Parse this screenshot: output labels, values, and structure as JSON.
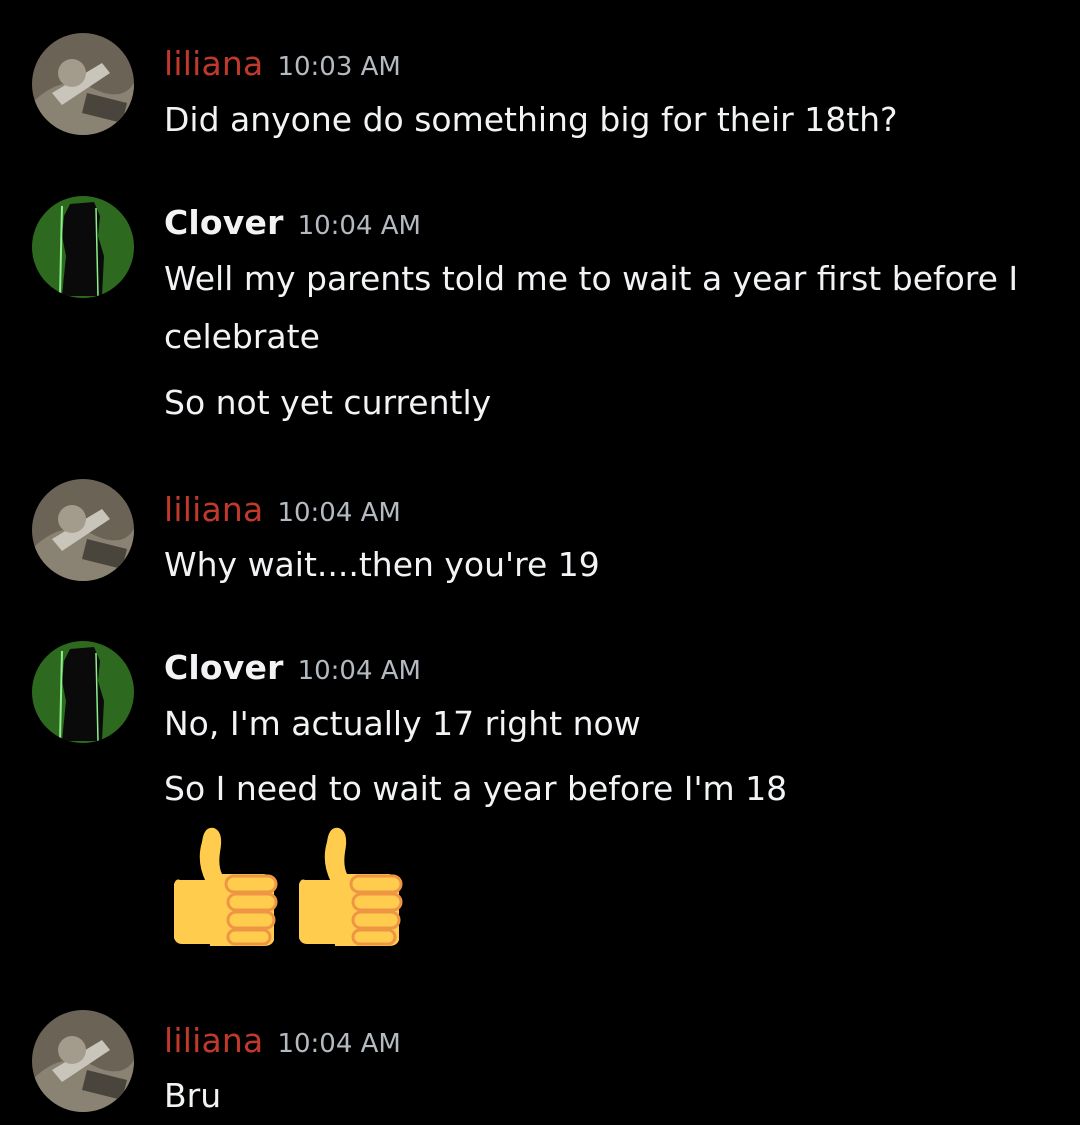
{
  "colors": {
    "background": "#000000",
    "liliana_name": "#c0392b",
    "text": "#f2f3f5",
    "timestamp": "#b5bac1",
    "clover_avatar_bg": "#2d6a1f",
    "thumbs_yellow": "#ffcc4d"
  },
  "messages": [
    {
      "author": "liliana",
      "time": "10:03 AM",
      "lines": [
        "Did anyone do something big for their 18th?"
      ]
    },
    {
      "author": "Clover",
      "time": "10:04 AM",
      "lines": [
        "Well my parents told me to wait a year first before I",
        "celebrate",
        "So not yet currently"
      ]
    },
    {
      "author": "liliana",
      "time": "10:04 AM",
      "lines": [
        "Why wait....then you're 19"
      ]
    },
    {
      "author": "Clover",
      "time": "10:04 AM",
      "lines": [
        "No, I'm actually 17 right now",
        "So I need to wait a year before I'm 18"
      ],
      "emojis": [
        "thumbs-up",
        "thumbs-up"
      ]
    },
    {
      "author": "liliana",
      "time": "10:04 AM",
      "lines": [
        "Bru"
      ]
    }
  ]
}
